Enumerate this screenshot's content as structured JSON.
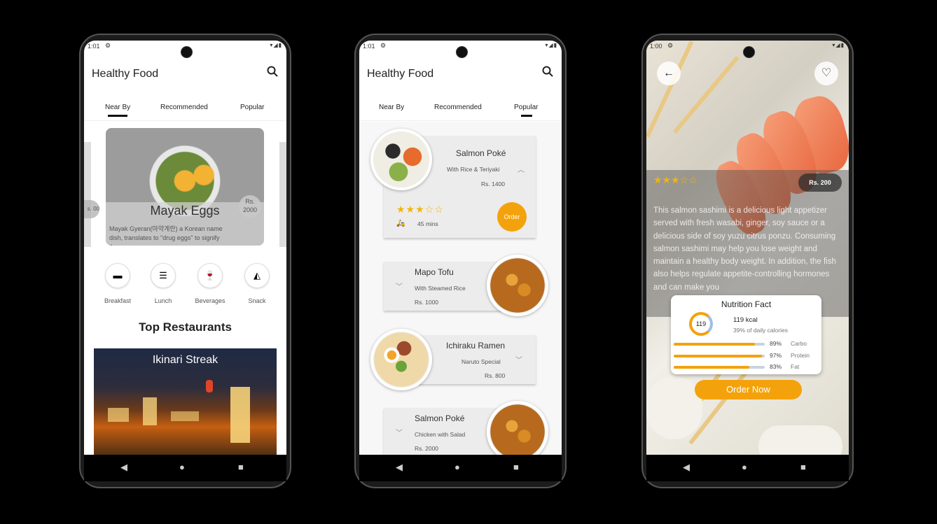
{
  "phone1": {
    "status_time": "1:01",
    "app_title": "Healthy Food",
    "tabs": [
      "Near By",
      "Recommended",
      "Popular"
    ],
    "active_tab": "Near By",
    "featured": {
      "name": "Mayak Eggs",
      "description": "Mayak Gyeran(마약계란) a Korean name dish, translates to \"drug eggs\" to signify the",
      "price": "Rs. 2000",
      "left_peek": "s. 00"
    },
    "categories": [
      {
        "label": "Breakfast",
        "icon": "toaster-icon"
      },
      {
        "label": "Lunch",
        "icon": "burger-icon"
      },
      {
        "label": "Beverages",
        "icon": "wine-glass-icon"
      },
      {
        "label": "Snack",
        "icon": "pizza-icon"
      }
    ],
    "section_title": "Top Restaurants",
    "restaurant_name": "Ikinari Streak"
  },
  "phone2": {
    "status_time": "1:01",
    "app_title": "Healthy Food",
    "tabs": [
      "Near By",
      "Recommended",
      "Popular"
    ],
    "active_tab": "Popular",
    "items": [
      {
        "title": "Salmon Poké",
        "subtitle": "With Rice & Teriyaki",
        "price": "Rs. 1400",
        "rating": 3,
        "time": "45 mins",
        "order": "Order"
      },
      {
        "title": "Mapo Tofu",
        "subtitle": "With Steamed Rice",
        "price": "Rs. 1000"
      },
      {
        "title": "Ichiraku Ramen",
        "subtitle": "Naruto Special",
        "price": "Rs. 800"
      },
      {
        "title": "Salmon Poké",
        "subtitle": "Chicken with Salad",
        "price": "Rs. 2000"
      }
    ]
  },
  "phone3": {
    "status_time": "1:00",
    "rating": 3,
    "price": "Rs. 200",
    "description": "This salmon sashimi is a delicious light appetizer served with fresh wasabi, ginger, soy sauce or a delicious side of soy yuzu citrus ponzu. Consuming salmon sashimi may help you lose weight and maintain a healthy body weight. In addition, the fish also helps regulate appetite-controlling hormones and can make you",
    "nutrition": {
      "title": "Nutrition Fact",
      "ring_value": "119",
      "kcal": "119 kcal",
      "daily": "39% of daily calories",
      "bars": [
        {
          "label": "Carbo",
          "pct_text": "89%",
          "pct": 89
        },
        {
          "label": "Protein",
          "pct_text": "97%",
          "pct": 97
        },
        {
          "label": "Fat",
          "pct_text": "83%",
          "pct": 83
        }
      ]
    },
    "order_button": "Order Now"
  },
  "colors": {
    "accent": "#f4a20c",
    "star": "#f6b400",
    "background": "#000000"
  }
}
